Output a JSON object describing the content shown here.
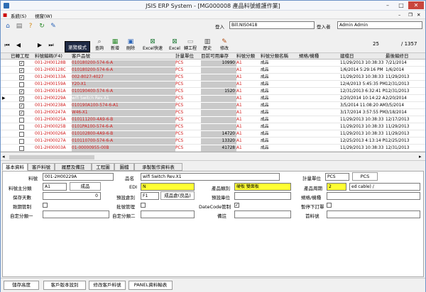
{
  "window": {
    "title": "JSIS ERP System - [MG000008 產品料號維護作業]"
  },
  "menu": [
    "系統(S)",
    "視窗(W)"
  ],
  "toolbar": {
    "mode_label": "瀏覽模式",
    "buttons": [
      "查詢",
      "新增",
      "刪除",
      "Excel快速",
      "Excel",
      "轉工程",
      "歷史",
      "修改"
    ],
    "login_label": "登入",
    "login_value": "Bill.NIS0418",
    "user_label": "登入者",
    "user_value": "Admin Admin",
    "record_current": "25",
    "record_total": "/ 1357"
  },
  "grid": {
    "headers": [
      "已轉工程",
      "料號編碼(F4)",
      "客戶品號",
      "計量單位",
      "目前可用庫存",
      "料號分類",
      "料號分類名稱",
      "規格/機種",
      "建檔日",
      "最後編修日"
    ],
    "rows": [
      {
        "conv": true,
        "part": "001-2H00128B",
        "cust": "010180200-574-6-A",
        "unit": "PCS",
        "stock": "10990",
        "cls": "A1",
        "clsname": "成品",
        "spec": "",
        "created": "11/29/2013 10:38:33",
        "edited": "7/21/2014"
      },
      {
        "conv": true,
        "part": "001-2H00128C",
        "cust": "010180200-574-6-A",
        "unit": "PCS",
        "stock": "",
        "cls": "A1",
        "clsname": "成品",
        "spec": "",
        "created": "1/6/2014 5:29:16 PM",
        "edited": "1/6/2014"
      },
      {
        "conv": true,
        "part": "001-2H00133A",
        "cust": "002-8027-4027",
        "unit": "PCS",
        "stock": "",
        "cls": "A1",
        "clsname": "成品",
        "spec": "",
        "created": "11/29/2013 10:38:33",
        "edited": "11/29/2013"
      },
      {
        "conv": false,
        "part": "001-2H00159A",
        "cust": "Y20-X1",
        "unit": "PCS",
        "stock": "",
        "cls": "A1",
        "clsname": "成品",
        "spec": "",
        "created": "12/4/2013 5:45:35 PM",
        "edited": "12/31/2013"
      },
      {
        "conv": true,
        "part": "001-2H00161A",
        "cust": "010190400-574-6-A",
        "unit": "PCS",
        "stock": "1520",
        "cls": "A1",
        "clsname": "成品",
        "spec": "",
        "created": "12/31/2013 6:32:41 PM",
        "edited": "12/31/2013"
      },
      {
        "conv": true,
        "part": "001-2H00229A",
        "cust": "wifi Switch Rev.X1",
        "unit": "PCS",
        "stock": "",
        "cls": "A1",
        "clsname": "成品",
        "spec": "",
        "created": "2/20/2014 10:14:22 AM",
        "edited": "2/20/2014"
      },
      {
        "conv": true,
        "part": "001-2H00238A",
        "cust": "010190A100-574-6-A1",
        "unit": "PCS",
        "stock": "",
        "cls": "A1",
        "clsname": "成品",
        "spec": "",
        "created": "3/5/2014 11:08:20 AM",
        "edited": "3/5/2014"
      },
      {
        "conv": true,
        "part": "001-2H00247A",
        "cust": "W46-X1",
        "unit": "PCS",
        "stock": "",
        "cls": "A1",
        "clsname": "成品",
        "spec": "",
        "created": "3/17/2014 3:57:55 PM",
        "edited": "3/18/2014"
      },
      {
        "conv": false,
        "part": "001-2H00025A",
        "cust": "010111200-4A9-6-B",
        "unit": "PCS",
        "stock": "",
        "cls": "A1",
        "clsname": "成品",
        "spec": "",
        "created": "11/29/2013 10:38:33",
        "edited": "12/17/2013"
      },
      {
        "conv": false,
        "part": "001-2H00025B",
        "cust": "0101PA100-574-6-A",
        "unit": "PCS",
        "stock": "",
        "cls": "A1",
        "clsname": "成品",
        "spec": "",
        "created": "11/29/2013 10:38:33",
        "edited": "11/29/2013"
      },
      {
        "conv": false,
        "part": "001-2H00026A",
        "cust": "010102800-4A9-6-B",
        "unit": "PCS",
        "stock": "14720",
        "cls": "A1",
        "clsname": "成品",
        "spec": "",
        "created": "11/29/2013 10:38:33",
        "edited": "11/29/2013"
      },
      {
        "conv": false,
        "part": "001-2H00027A",
        "cust": "010110700-574-6-A",
        "unit": "PCS",
        "stock": "13320",
        "cls": "A1",
        "clsname": "成品",
        "spec": "",
        "created": "12/25/2013 4:13:14 PM",
        "edited": "12/25/2013"
      },
      {
        "conv": false,
        "part": "001-2H00003A",
        "cust": "01-00000955-00B",
        "unit": "PCS",
        "stock": "41728",
        "cls": "A1",
        "clsname": "成品",
        "spec": "",
        "created": "11/29/2013 10:38:33",
        "edited": "12/31/2013"
      }
    ]
  },
  "tabs": [
    "基本資料",
    "客戶料號",
    "履歷及備註",
    "工程圖",
    "圖檔",
    "承製製作資料表"
  ],
  "form": {
    "part_label": "料號",
    "part_value": "001-2H00229A",
    "name_label": "品名",
    "name_value": "wifi Switch Rev.X1",
    "unit_label": "計量單位",
    "unit_value": "PCS",
    "unit_btn": "PCS",
    "cls_label": "料號主分類",
    "cls_value": "A1",
    "cls_btn": "成品",
    "edi_label": "EDI",
    "edi_value": "N",
    "prodcls_label": "產品類別",
    "prodcls_value": "硬板 雙面板",
    "cycle_label": "產品周期",
    "cycle_value": "2",
    "cycle_extra": "ed cable) /",
    "safe_label": "保存天數",
    "safe_value": "0",
    "defloc_label": "預設倉別",
    "defloc_value": "F1",
    "defloc_btn": "成品倉(良品)",
    "defrate_label": "預設庫位",
    "spec_label": "規格/機種",
    "serial_label": "致期管制",
    "batch_label": "批號管理",
    "datecode_label": "DateCode管制",
    "stop_label": "暫停下訂單",
    "cat1_label": "自定分類一",
    "cat2_label": "自定分類二",
    "memo_label": "備註",
    "mfr_label": "首料號"
  },
  "bottom": [
    "儲存高度",
    "客戶版本設別",
    "修改客戶料號",
    "PANEL資料輸表"
  ],
  "colors": {
    "red_text": "#d11a1a",
    "selected_yellow": "#ffff33",
    "grey_cell": "#c9c9c9",
    "mode_bg": "#1f2a44"
  }
}
